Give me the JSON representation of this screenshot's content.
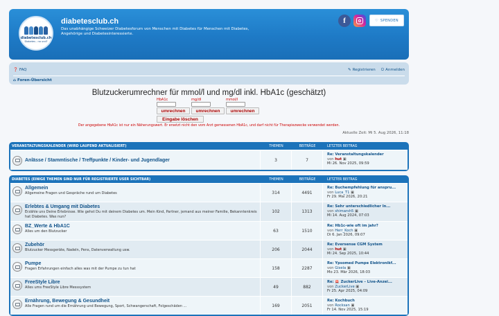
{
  "header": {
    "site_title": "diabetesclub.ch",
    "site_description": "Das unabhängige Schweizer Diabetesforum von Menschen mit Diabetes für Menschen mit Diabetes, Angehörige und Diabetesinteressierte.",
    "logo_text": "diabetesclub.ch",
    "logo_subtext": "Diabetes - na und?",
    "facebook_glyph": "f",
    "donate_label": "SPENDEN"
  },
  "nav": {
    "faq": "FAQ",
    "register": "Registrieren",
    "login": "Anmelden",
    "breadcrumb": "Foren-Übersicht"
  },
  "calculator": {
    "title": "Blutzuckerumrechner für mmol/l und mg/dl inkl. HbA1c (geschätzt)",
    "label_hba1c": "HbA1c",
    "label_mgdl": "mg/dl",
    "label_mmoll": "mmol/l",
    "btn_convert": "umrechnen",
    "btn_clear": "Eingabe löschen",
    "note": "Der angegebene HbA1c ist nur ein Näherungswert. Er ersetzt nicht den vom Arzt gemessenen HbA1c, und darf nicht für Therapiezwecke verwendet werden."
  },
  "datetime": "Aktuelle Zeit: Mi 5. Aug 2026, 11:18",
  "columns": {
    "topics": "THEMEN",
    "posts": "BEITRÄGE",
    "last_post": "LETZTER BEITRAG"
  },
  "last_by_prefix": "von",
  "sections": [
    {
      "title": "VERANSTALTUNGSKALENDER (WIRD LAUFEND AKTUALISIERT)",
      "forums": [
        {
          "name": "Anlässe / Stammtische / Treffpunkte / Kinder- und Jugendlager",
          "desc": "",
          "topics": "3",
          "posts": "7",
          "last_title": "Re: Veranstaltungskalender",
          "last_author": "hut",
          "last_date": "Mi 26. Nov 2025, 09:59"
        }
      ]
    },
    {
      "title": "DIABETES (EINIGE THEMEN SIND NUR FÜR REGISTRIERTE USER SICHTBAR)",
      "forums": [
        {
          "name": "Allgemein",
          "desc": "Allgemeine Fragen und Gespräche rund um Diabetes",
          "topics": "314",
          "posts": "4491",
          "last_title": "Re: Buchempfehlung für anspru...",
          "last_author": "Luca_T1",
          "last_date": "Fr 29. Mai 2026, 20:21"
        },
        {
          "name": "Erlebtes & Umgang mit Diabetes",
          "desc": "Erzähle uns Deine Erlebnisse. Wie gehst Du mit deinem Diabetes um. Mein Kind, Partner, jemand aus meiner Familie, Bekanntenkreis hat Diabetes. Was nun?",
          "topics": "102",
          "posts": "1313",
          "last_title": "Re: Sehr unterschiedlicher In...",
          "last_author": "shimarsh5",
          "last_date": "Mi 14. Aug 2024, 07:03"
        },
        {
          "name": "BZ_Werte & HbA1C",
          "desc": "Alles um den Blutzucker",
          "topics": "63",
          "posts": "1510",
          "last_title": "Re: Hb1c-wie oft im jahr?",
          "last_author": "Herr_Koch",
          "last_date": "Di 6. Jan 2026, 09:07"
        },
        {
          "name": "Zubehör",
          "desc": "Blutzucker Messgeräte, Nadeln, Pens, Datenverwaltung usw.",
          "topics": "206",
          "posts": "2044",
          "last_title": "Re: Eversense CGM System",
          "last_author": "hut",
          "last_date": "Mi 24. Sep 2025, 10:44"
        },
        {
          "name": "Pumpe",
          "desc": "Fragen Erfahrungen einfach alles was mit der Pumpe zu tun hat",
          "topics": "158",
          "posts": "2287",
          "last_title": "Re: Ypsomed Pumpe Elektronikf...",
          "last_author": "Gisela",
          "last_date": "Mo 23. Mär 2026, 18:03"
        },
        {
          "name": "FreeStyle Libre",
          "desc": "Alles ums FreeStyle Libre Messsystem",
          "topics": "49",
          "posts": "882",
          "last_title": "Re: 🚨 ZuckerLive – Live-Anzei...",
          "last_author": "ZuckerLive",
          "last_date": "Fr 25. Apr 2025, 04:09"
        },
        {
          "name": "Ernährung, Bewegung & Gesundheit",
          "desc": "Alle Fragen rund um die Ernährung und Bewegung, Sport, Schwangerschaft, Folgeschäden ...",
          "topics": "169",
          "posts": "2051",
          "last_title": "Re: Kochbuch",
          "last_author": "Rocksan",
          "last_date": "Fr 14. Nov 2025, 15:19"
        }
      ]
    }
  ],
  "colors": {
    "header_blue": "#1e7ac6",
    "forum_blue": "#1c73ba",
    "link_blue": "#105289",
    "accent_red": "#aa0000"
  }
}
